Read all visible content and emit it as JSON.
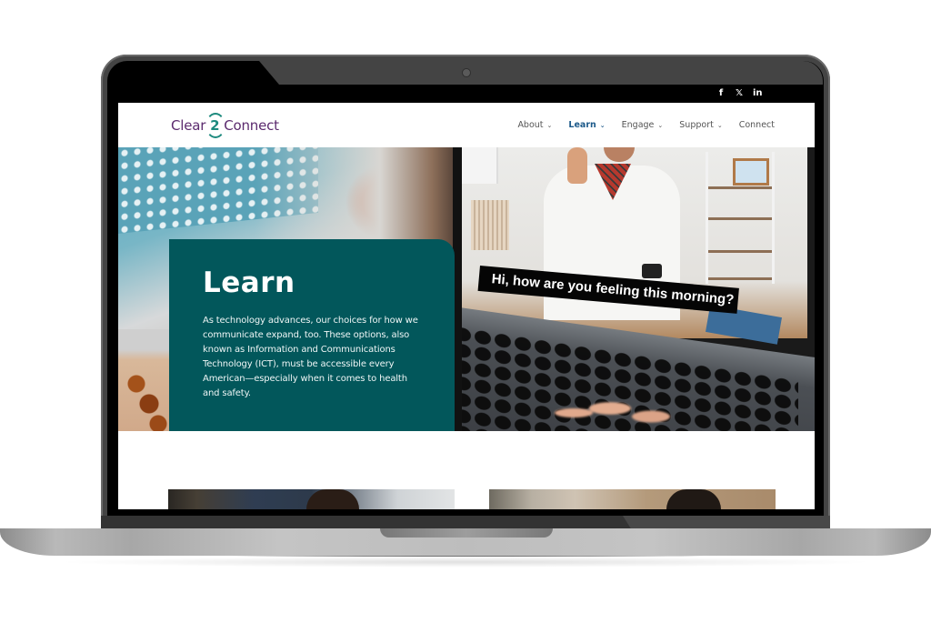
{
  "site": {
    "logo": {
      "part1": "Clear",
      "part2": "2",
      "part3": "Connect"
    },
    "social": [
      {
        "icon": "facebook-icon",
        "glyph": "f"
      },
      {
        "icon": "x-twitter-icon",
        "glyph": "𝕏"
      },
      {
        "icon": "linkedin-icon",
        "glyph": "in"
      }
    ],
    "nav": [
      {
        "label": "About",
        "dropdown": true,
        "active": false
      },
      {
        "label": "Learn",
        "dropdown": true,
        "active": true
      },
      {
        "label": "Engage",
        "dropdown": true,
        "active": false
      },
      {
        "label": "Support",
        "dropdown": true,
        "active": false
      },
      {
        "label": "Connect",
        "dropdown": false,
        "active": false
      }
    ],
    "chevron": "⌄"
  },
  "hero": {
    "title": "Learn",
    "body": "As technology advances, our choices for how we communicate expand, too. These options, also known as Information and Communications Technology (ICT), must be accessible every American—especially when it comes to health and safety.",
    "image_caption": "Hi, how are you feeling this morning?"
  },
  "colors": {
    "brand_purple": "#5b2a6e",
    "brand_teal": "#1d8a7e",
    "card_teal": "#02575b",
    "nav_active": "#1d5a8a"
  }
}
